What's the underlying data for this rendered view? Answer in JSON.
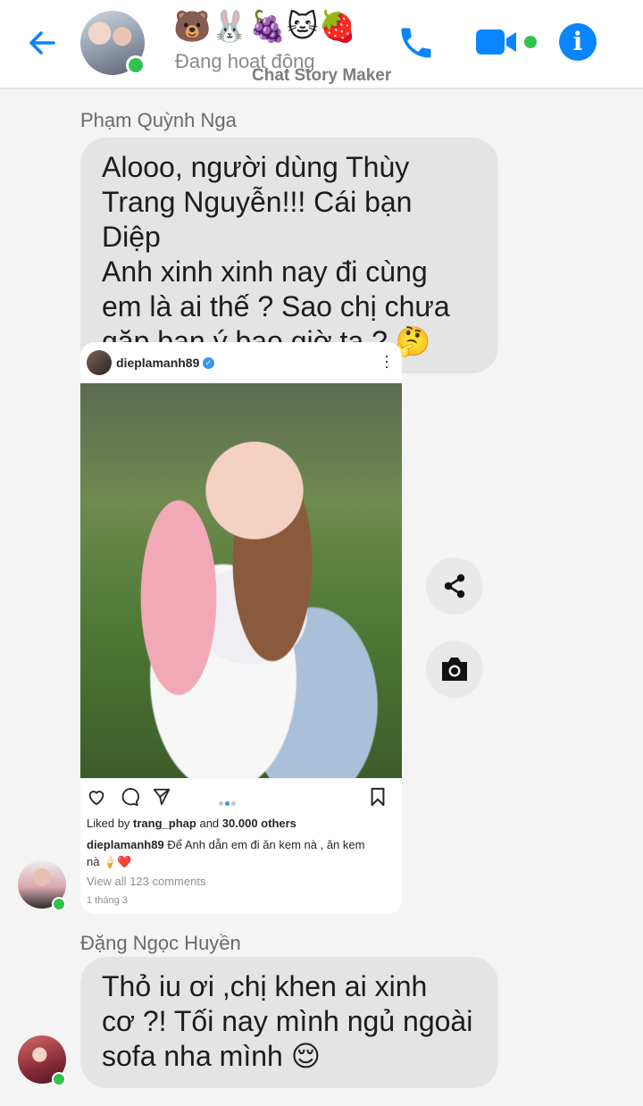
{
  "header": {
    "contact_title": "🐻🐰🍇🐱🍓",
    "status": "Đang hoạt động",
    "watermark": "Chat Story Maker"
  },
  "messages": [
    {
      "sender": "Phạm Quỳnh Nga",
      "lines": [
        "Alooo, người dùng Thùy",
        "Trang Nguyễn!!! Cái bạn Diệp",
        "Anh xinh xinh nay đi cùng",
        "em là ai thế ? Sao chị chưa",
        "gặp bạn ý bao giờ ta ? 🤔"
      ]
    },
    {
      "sender": "Đặng Ngọc Huyền",
      "lines": [
        "Thỏ iu ơi ,chị khen ai xinh",
        "cơ ?! Tối nay mình ngủ ngoài",
        "sofa nha mình 😌"
      ]
    }
  ],
  "instagram_post": {
    "username": "dieplamanh89",
    "verified_mark": "✓",
    "liked_by_prefix": "Liked by",
    "liked_by_user": "trang_phap",
    "liked_by_suffix": "and",
    "likes_count": "30.000 others",
    "caption_user": "dieplamanh89",
    "caption_line1": "Để Anh dẫn em đi ăn kem nà , ăn kem",
    "caption_line2": "nà 🍦❤️",
    "view_all_prefix": "View all",
    "comments_count": "123 comments",
    "date": "1 tháng 3"
  },
  "colors": {
    "accent": "#0a84ff",
    "online": "#31c24d",
    "bubble": "#e4e4e4",
    "chat_background": "#f4f4f4"
  }
}
